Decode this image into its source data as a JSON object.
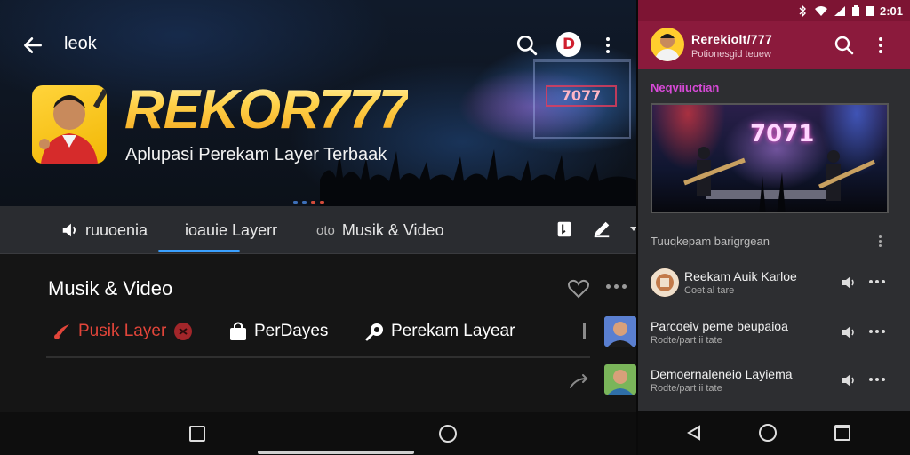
{
  "left_app": {
    "title": "leok",
    "app_name": "REKOR777",
    "tagline": "Aplupasi Perekam Layer Terbaak",
    "stage_logo": "7077",
    "tabs": [
      {
        "label": "ruuoenia"
      },
      {
        "label": "ioauie Layerr"
      },
      {
        "label": "Musik & Video",
        "prefix": "oto"
      }
    ],
    "section": {
      "title": "Musik & Video",
      "chips": [
        {
          "label": "Pusik Layer",
          "color": "#e2453a"
        },
        {
          "label": "PerDayes"
        },
        {
          "label": "Perekam Layear"
        }
      ]
    }
  },
  "phone": {
    "status_time": "2:01",
    "title": "Rerekiolt/777",
    "subtitle": "Potionesgid teuew",
    "now_playing_label": "Neqviiuctian",
    "concert_logo": "7071",
    "section_header": "Tuuqkepam barigrgean",
    "rows": [
      {
        "title": "Reekam Auik Karloe",
        "sub": "Coetial tare"
      },
      {
        "title": "Parcoeiv peme beupaioa",
        "sub": "Rodte/part ii tate"
      },
      {
        "title": "Demoernaleneio Layiema",
        "sub": "Rodte/part ii tate"
      }
    ]
  },
  "colors": {
    "accent_tab": "#3aa0ff",
    "phone_appbar": "#8b1a3c",
    "brand_gold": "#ffd24a",
    "now_playing": "#d84ad8"
  }
}
